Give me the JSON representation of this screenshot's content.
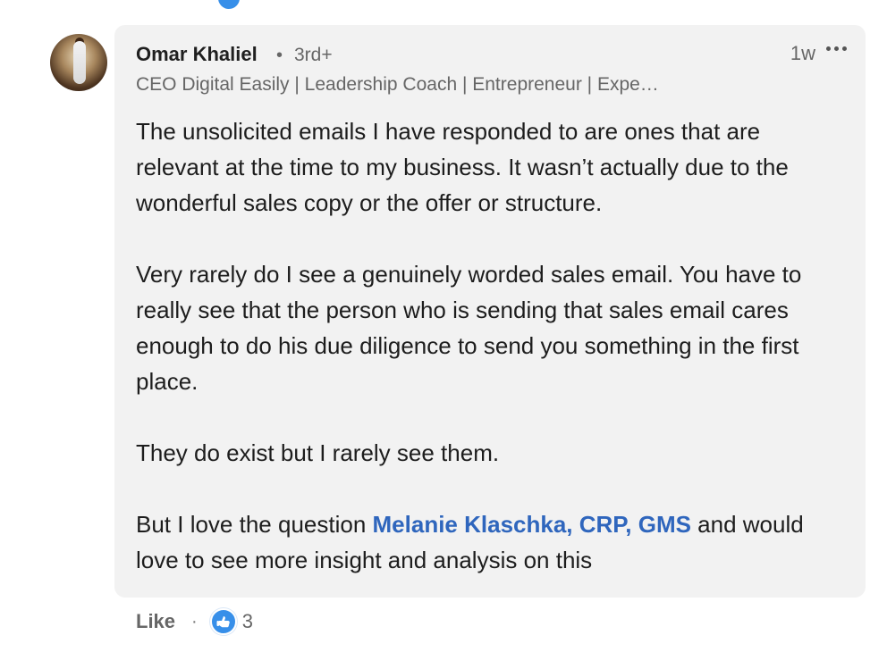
{
  "comment": {
    "author": "Omar Khaliel",
    "connection_degree": "3rd+",
    "headline": "CEO Digital Easily | Leadership Coach | Entrepreneur | Expe…",
    "time_ago": "1w",
    "body": {
      "paragraph_1": "The unsolicited emails I have responded to are ones that are relevant at the time to my business. It wasn’t actually due to the wonderful sales copy or the offer or structure.",
      "paragraph_2": "Very rarely do I see a genuinely worded sales email. You have to really see that the person who is sending that sales email cares enough to do his due diligence to send you something in the first place.",
      "paragraph_3": "They do exist but I rarely see them.",
      "paragraph_4_before_mention": "But I love the question ",
      "mention": "Melanie Klaschka, CRP, GMS",
      "paragraph_4_after_mention": " and would love to see more insight and analysis on this"
    }
  },
  "actions": {
    "like_label": "Like",
    "separator": "·",
    "reaction_count": "3"
  },
  "icons": {
    "more": "more-options-icon",
    "reaction": "like-reaction-icon"
  },
  "colors": {
    "bubble_background": "#f2f2f2",
    "mention": "#2f66bd",
    "reaction_blue": "#378fe9"
  }
}
